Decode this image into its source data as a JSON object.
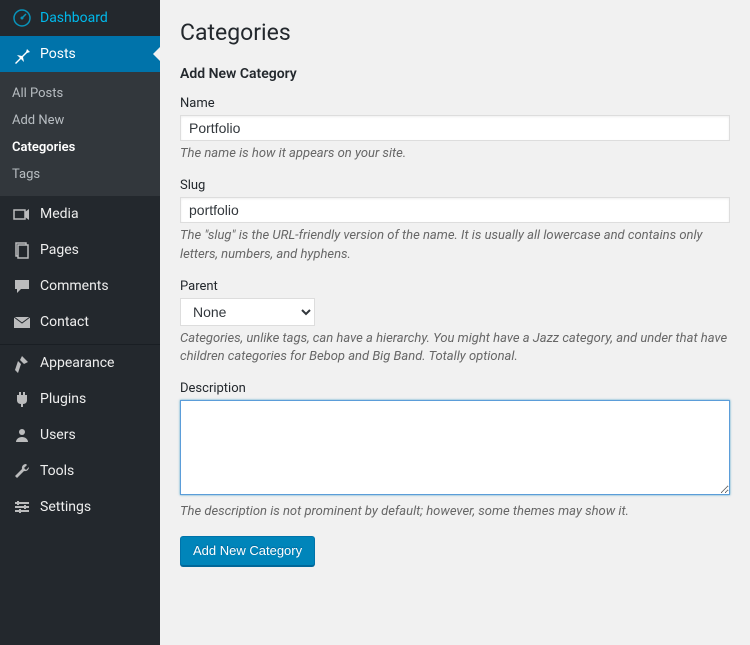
{
  "sidebar": {
    "dashboard": "Dashboard",
    "posts": "Posts",
    "submenu": {
      "all": "All Posts",
      "add": "Add New",
      "categories": "Categories",
      "tags": "Tags"
    },
    "media": "Media",
    "pages": "Pages",
    "comments": "Comments",
    "contact": "Contact",
    "appearance": "Appearance",
    "plugins": "Plugins",
    "users": "Users",
    "tools": "Tools",
    "settings": "Settings"
  },
  "page": {
    "title": "Categories",
    "section_title": "Add New Category"
  },
  "form": {
    "name": {
      "label": "Name",
      "value": "Portfolio",
      "help": "The name is how it appears on your site."
    },
    "slug": {
      "label": "Slug",
      "value": "portfolio",
      "help": "The \"slug\" is the URL-friendly version of the name. It is usually all lowercase and contains only letters, numbers, and hyphens."
    },
    "parent": {
      "label": "Parent",
      "selected": "None",
      "help": "Categories, unlike tags, can have a hierarchy. You might have a Jazz category, and under that have children categories for Bebop and Big Band. Totally optional."
    },
    "description": {
      "label": "Description",
      "value": "",
      "help": "The description is not prominent by default; however, some themes may show it."
    },
    "submit": "Add New Category"
  }
}
